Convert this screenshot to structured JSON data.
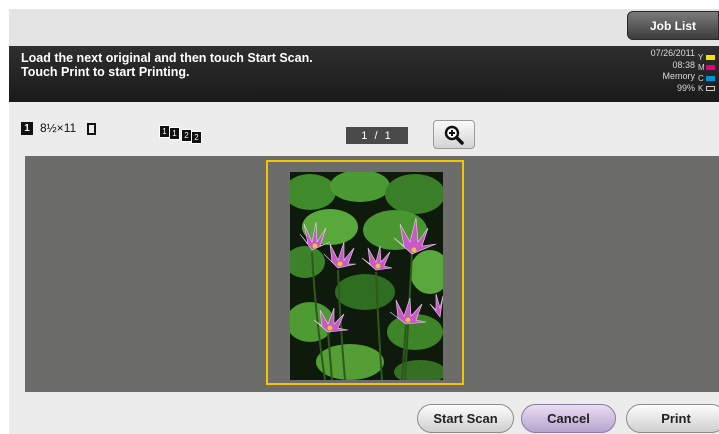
{
  "header": {
    "job_list_label": "Job List",
    "message_line1": "Load the next original and then touch Start Scan.",
    "message_line2": "Touch Print to start Printing."
  },
  "status": {
    "date": "07/26/2011",
    "time": "08:38",
    "memory_label": "Memory",
    "memory_value": "99%",
    "toner": [
      {
        "letter": "Y",
        "color": "#f5e400"
      },
      {
        "letter": "M",
        "color": "#e0007a"
      },
      {
        "letter": "C",
        "color": "#0093d6"
      },
      {
        "letter": "K",
        "color": "#222222"
      }
    ]
  },
  "info": {
    "copy_count": "1",
    "paper_size": "8½×11",
    "collate_pages": [
      "1",
      "1",
      "2",
      "2"
    ],
    "page_counter": "1 / 1"
  },
  "buttons": {
    "start_scan": "Start Scan",
    "cancel": "Cancel",
    "print": "Print"
  },
  "colors": {
    "preview_highlight": "#f4c400",
    "cancel_button": "#b7a3cf"
  }
}
